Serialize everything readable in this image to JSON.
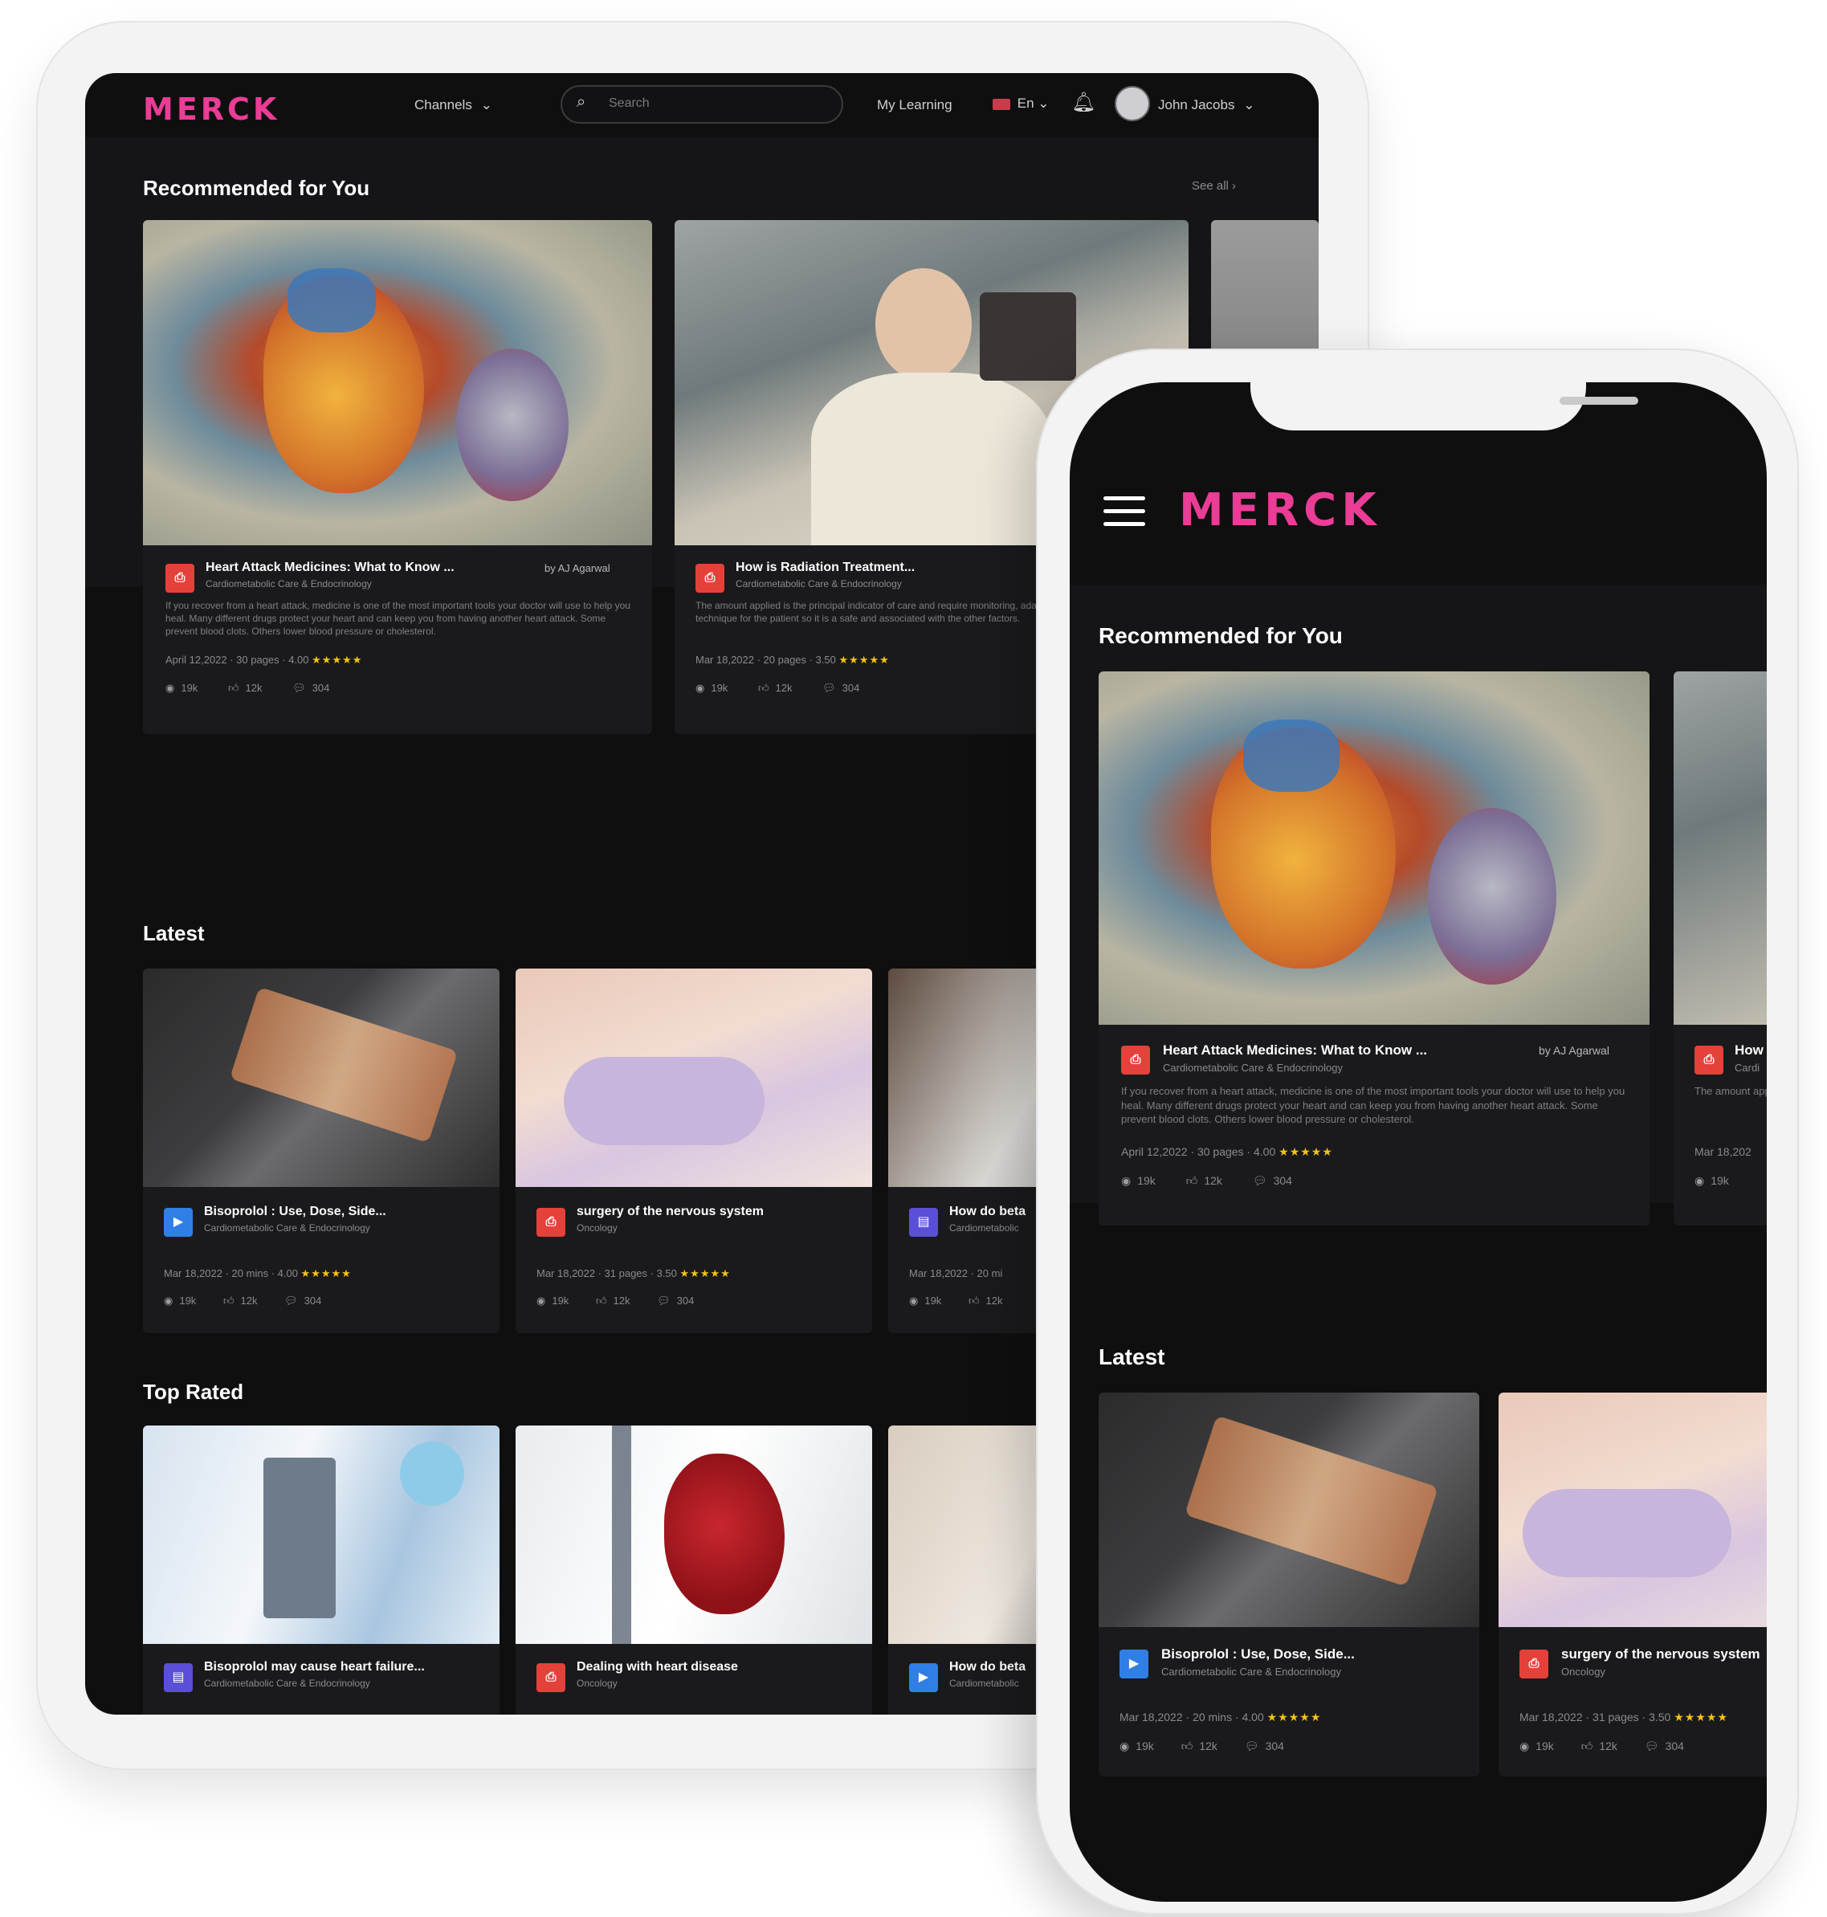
{
  "brand": {
    "logo": "MERCK",
    "accent": "#eb3c96"
  },
  "header": {
    "channels_label": "Channels",
    "search_placeholder": "Search",
    "my_learning": "My Learning",
    "language": "En",
    "user_name": "John Jacobs"
  },
  "recommended": {
    "title": "Recommended for You",
    "see_all": "See all",
    "cards": [
      {
        "title": "Heart Attack Medicines: What to Know ...",
        "author": "by AJ Agarwal",
        "category": "Cardiometabolic Care & Endocrinology",
        "desc": "If you recover from a heart attack, medicine is one of the most important tools your doctor will use to help you heal. Many different drugs protect your heart and can keep you from having another heart attack. Some prevent blood clots. Others lower blood pressure or cholesterol.",
        "meta": "April 12,2022 · 30 pages · 4.00",
        "stars": "★★★★★",
        "views": "19k",
        "likes": "12k",
        "comments": "304"
      },
      {
        "title": "How is Radiation Treatment...",
        "author": "",
        "category": "Cardiometabolic Care & Endocrinology",
        "desc": "The amount applied is the principal indicator of care and require monitoring, adapting the dose and technique for the patient so it is a safe and associated with the other factors.",
        "meta": "Mar 18,2022 · 20 pages · 3.50",
        "stars": "★★★★★",
        "views": "19k",
        "likes": "12k",
        "comments": "304"
      }
    ]
  },
  "latest": {
    "title": "Latest",
    "cards": [
      {
        "icon": "video",
        "title": "Bisoprolol : Use, Dose, Side...",
        "category": "Cardiometabolic Care & Endocrinology",
        "meta": "Mar 18,2022 · 20 mins · 4.00",
        "stars": "★★★★★",
        "views": "19k",
        "likes": "12k",
        "comments": "304"
      },
      {
        "icon": "pdf",
        "title": "surgery of the nervous system",
        "category": "Oncology",
        "meta": "Mar 18,2022 · 31 pages · 3.50",
        "stars": "★★★★★",
        "views": "19k",
        "likes": "12k",
        "comments": "304"
      },
      {
        "icon": "doc",
        "title": "How do beta",
        "category": "Cardiometabolic",
        "meta": "Mar 18,2022 · 20 mi",
        "stars": "",
        "views": "19k",
        "likes": "12k",
        "comments": ""
      }
    ]
  },
  "top_rated": {
    "title": "Top Rated",
    "cards": [
      {
        "icon": "doc",
        "title": "Bisoprolol may cause heart failure...",
        "category": "Cardiometabolic Care & Endocrinology"
      },
      {
        "icon": "pdf",
        "title": "Dealing with heart disease",
        "category": "Oncology"
      },
      {
        "icon": "video",
        "title": "How do beta",
        "category": "Cardiometabolic"
      }
    ]
  },
  "mobile": {
    "logo": "MERCK",
    "recommended_title": "Recommended for You",
    "rec_card": {
      "title": "Heart Attack Medicines: What to Know ...",
      "author": "by AJ Agarwal",
      "category": "Cardiometabolic Care & Endocrinology",
      "desc": "If you recover from a heart attack, medicine is one of the most important tools your doctor will use to help you heal. Many different drugs protect your heart and can keep you from having another heart attack. Some prevent blood clots. Others lower blood pressure or cholesterol.",
      "meta": "April 12,2022 · 30 pages · 4.00",
      "stars": "★★★★★",
      "views": "19k",
      "likes": "12k",
      "comments": "304"
    },
    "rec_card2": {
      "title": "How",
      "category": "Cardi",
      "desc": "The amount applied",
      "meta": "Mar 18,202",
      "views": "19k"
    },
    "latest_title": "Latest",
    "latest_cards": [
      {
        "title": "Bisoprolol : Use, Dose, Side...",
        "category": "Cardiometabolic Care & Endocrinology",
        "meta": "Mar 18,2022 · 20 mins · 4.00",
        "stars": "★★★★★",
        "views": "19k",
        "likes": "12k",
        "comments": "304"
      },
      {
        "title": "surgery of the nervous system",
        "category": "Oncology",
        "meta": "Mar 18,2022 · 31 pages · 3.50",
        "stars": "★★★★★",
        "views": "19k",
        "likes": "12k",
        "comments": "304"
      }
    ]
  }
}
